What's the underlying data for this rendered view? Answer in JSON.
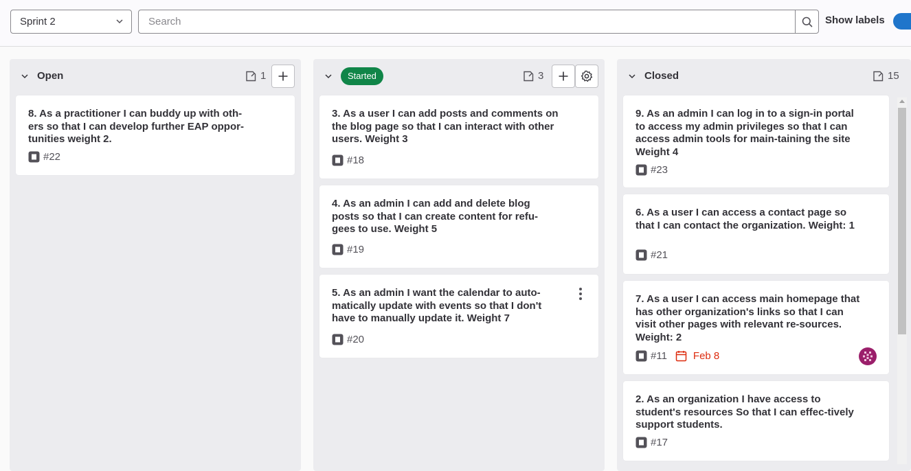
{
  "filters": {
    "iteration_value": "Sprint 2",
    "search_placeholder": "Search",
    "show_labels_label": "Show labels",
    "show_labels_on": true
  },
  "colors": {
    "accent": "#1f75cb",
    "started_badge": "#108548",
    "due_date": "#dd2b0e",
    "list_bg": "#ececef"
  },
  "lists": [
    {
      "title": "Open",
      "count": "1",
      "cards": [
        {
          "title": "8. As a practitioner I can buddy up with oth-ers so that I can develop further EAP oppor-tunities weight 2.",
          "ref": "#22"
        }
      ]
    },
    {
      "title": "Started",
      "count": "3",
      "cards": [
        {
          "title": "3. As a user I can add posts and comments on the blog page so that I can interact with other users. Weight 3",
          "ref": "#18"
        },
        {
          "title": "4. As an admin I can add and delete blog posts so that I can create content for refu-gees to use. Weight 5",
          "ref": "#19"
        },
        {
          "title": "5. As an admin I want the calendar to auto-matically update with events so that I don't have to manually update it. Weight 7",
          "ref": "#20"
        }
      ]
    },
    {
      "title": "Closed",
      "count": "15",
      "cards": [
        {
          "title": "9. As an admin I can log in to a sign-in portal to access my admin privileges so that I can access admin tools for main-taining the site Weight 4",
          "ref": "#23"
        },
        {
          "title": "6. As a user I can access a contact page so that I can contact the organization. Weight: 1",
          "ref": "#21"
        },
        {
          "title": "7. As a user I can access main homepage that has other organization's links so that I can visit other pages with relevant re-sources. Weight: 2",
          "ref": "#11",
          "due": "Feb 8"
        },
        {
          "title": "2. As an organization I have access to student's resources So that I can effec-tively support students.",
          "ref": "#17"
        }
      ]
    }
  ]
}
